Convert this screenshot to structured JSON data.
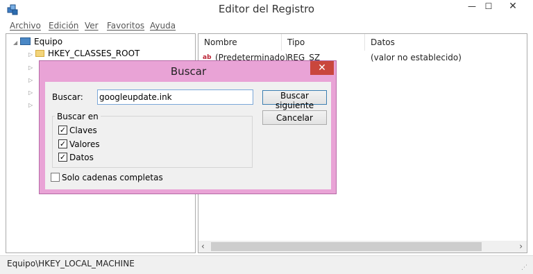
{
  "window": {
    "title": "Editor del Registro",
    "min_glyph": "—",
    "max_glyph": "☐",
    "close_glyph": "✕"
  },
  "menu": {
    "archivo": "Archivo",
    "edicion": "Edición",
    "ver": "Ver",
    "favoritos": "Favoritos",
    "ayuda": "Ayuda"
  },
  "tree": {
    "root": "Equipo",
    "items": [
      "HKEY_CLASSES_ROOT"
    ]
  },
  "list": {
    "columns": [
      "Nombre",
      "Tipo",
      "Datos"
    ],
    "rows": [
      {
        "nombre": "(Predeterminado)",
        "tipo": "REG_SZ",
        "datos": "(valor no establecido)"
      }
    ]
  },
  "statusbar": {
    "path": "Equipo\\HKEY_LOCAL_MACHINE"
  },
  "dialog": {
    "title": "Buscar",
    "close_glyph": "✕",
    "search_label": "Buscar:",
    "search_value": "googleupdate.ink",
    "find_next_label": "Buscar siguiente",
    "cancel_label": "Cancelar",
    "group_label": "Buscar en",
    "options": [
      {
        "label": "Claves",
        "checked": true
      },
      {
        "label": "Valores",
        "checked": true
      },
      {
        "label": "Datos",
        "checked": true
      }
    ],
    "whole_string": {
      "label": "Solo cadenas completas",
      "checked": false
    }
  },
  "icons": {
    "app": "registry-editor-icon",
    "computer": "computer-icon",
    "folder": "folder-icon",
    "string_value": "string-value-icon"
  },
  "colors": {
    "dialog_frame": "#e9a3d6",
    "close_button": "#c9463d",
    "input_border": "#7aa7d8"
  }
}
